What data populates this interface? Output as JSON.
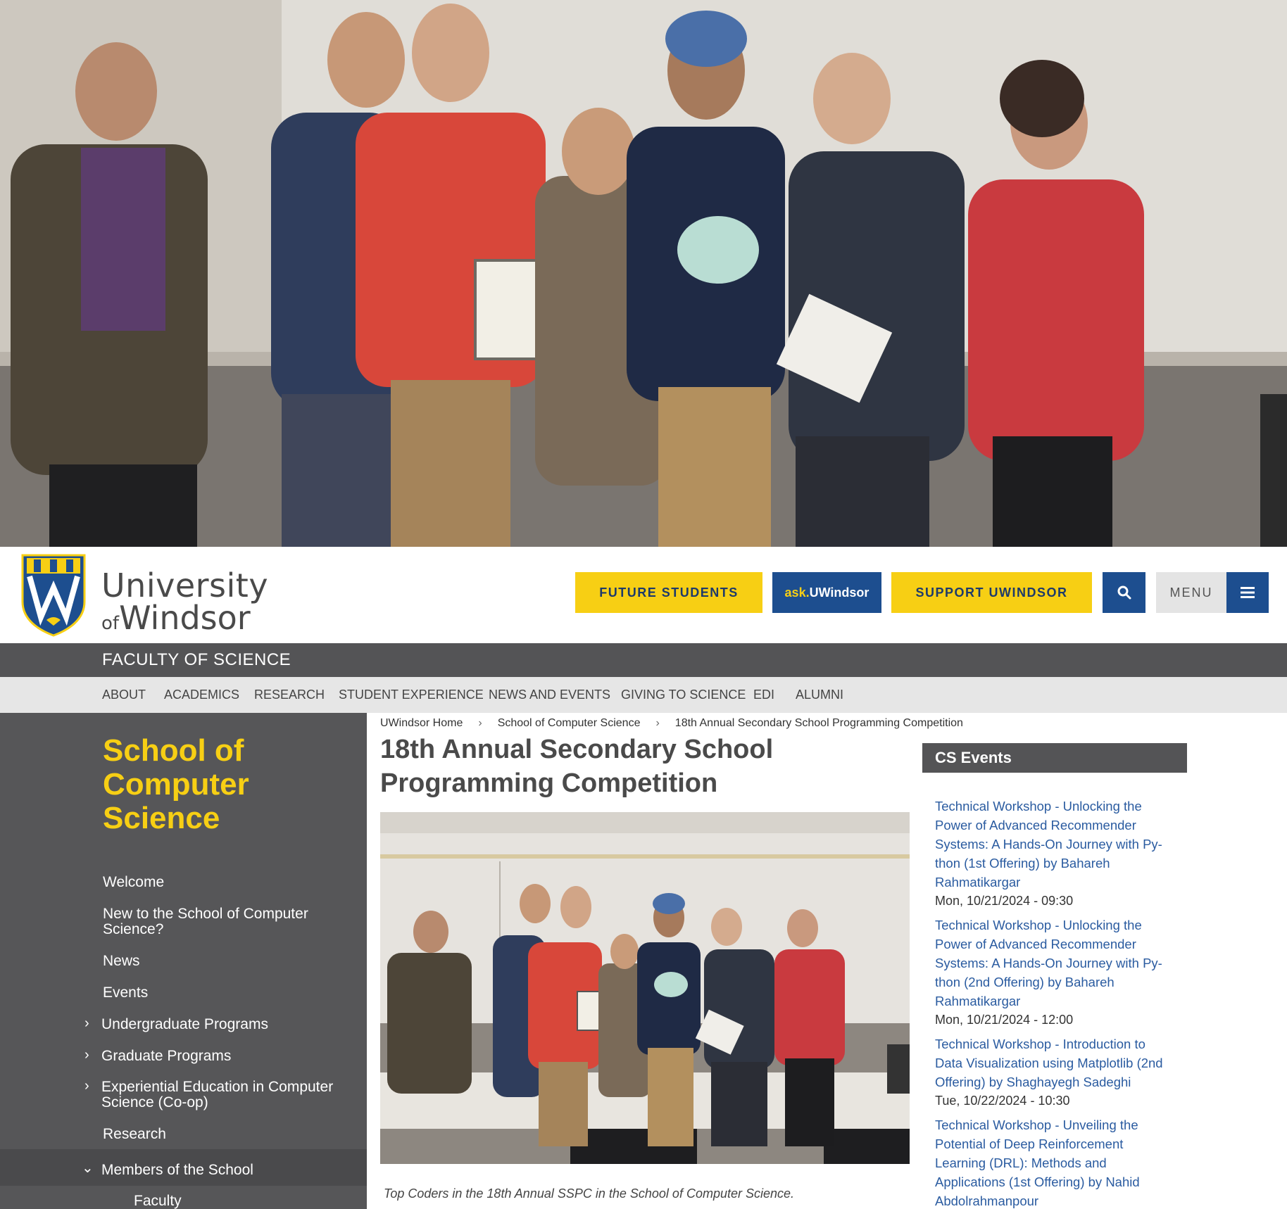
{
  "hero": {
    "alt": "hero-photo"
  },
  "brand": {
    "line1": "University",
    "of": "of",
    "line2": "Windsor"
  },
  "header_buttons": {
    "future_students": "FUTURE STUDENTS",
    "ask_prefix": "ask.",
    "ask_suffix": "UWindsor",
    "support": "SUPPORT UWINDSOR",
    "menu": "MENU"
  },
  "faculty": {
    "title": "FACULTY OF SCIENCE"
  },
  "topnav": [
    "ABOUT",
    "ACADEMICS",
    "RESEARCH",
    "STUDENT EXPERIENCE",
    "NEWS AND EVENTS",
    "GIVING TO SCIENCE",
    "EDI",
    "ALUMNI"
  ],
  "sidebar": {
    "school_title": "School of Computer Science",
    "items": [
      "Welcome",
      "New to the School of Computer Science?",
      "News",
      "Events",
      "Undergraduate Programs",
      "Graduate Programs",
      "Experiential Education in Computer Science (Co-op)",
      "Research",
      "Members of the School",
      "Faculty"
    ]
  },
  "breadcrumb": [
    "UWindsor Home",
    "School of Computer Science",
    "18th Annual Secondary School Programming Competition"
  ],
  "page": {
    "title": "18th Annual Secondary School Programming Competition",
    "caption": "Top Coders in the 18th Annual SSPC in the School of Computer Science."
  },
  "events": {
    "heading": "CS Events",
    "items": [
      {
        "title": "Technical Workshop - Unlocking the Power of Advanced Recommender Systems: A Hands-On Journey with Py- thon (1st Offering) by Bahareh Rahmatikargar",
        "date": "Mon, 10/21/2024 - 09:30"
      },
      {
        "title": "Technical Workshop - Unlocking the Power of Advanced Recommender Systems: A Hands-On Journey with Py- thon (2nd Offering) by Bahareh Rahmatikargar",
        "date": "Mon, 10/21/2024 - 12:00"
      },
      {
        "title": "Technical Workshop - Introduction to Data Visualization using Matplotlib (2nd Offering) by Shaghayegh Sadeghi",
        "date": "Tue, 10/22/2024 - 10:30"
      },
      {
        "title": "Technical Workshop - Unveiling the Potential of Deep Reinforcement Learning (DRL): Methods and Applications (1st Offering) by Nahid Abdolrahmanpour",
        "date": ""
      }
    ]
  },
  "colors": {
    "gold": "#f7cf14",
    "blue": "#1d4e8f",
    "dark_gray": "#545456",
    "link": "#2a5ba0"
  }
}
